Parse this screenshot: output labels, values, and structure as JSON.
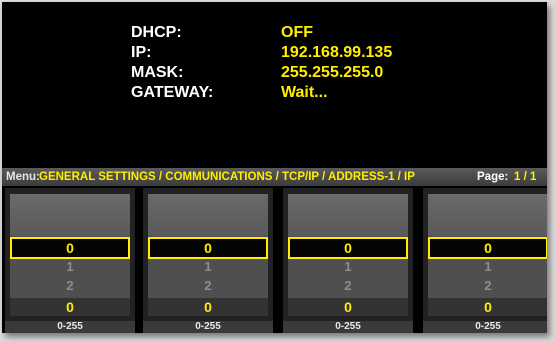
{
  "info": [
    {
      "label": "DHCP:",
      "value": "OFF"
    },
    {
      "label": "IP:",
      "value": "192.168.99.135"
    },
    {
      "label": "MASK:",
      "value": "255.255.255.0"
    },
    {
      "label": "GATEWAY:",
      "value": "Wait..."
    }
  ],
  "menu": {
    "label": "Menu:",
    "path": "GENERAL SETTINGS / COMMUNICATIONS / TCP/IP / ADDRESS-1 / IP",
    "page_label": "Page:",
    "page_value": "1 / 1"
  },
  "columns": [
    {
      "selected": "0",
      "options": [
        "1",
        "2"
      ],
      "current": "0",
      "range": "0-255"
    },
    {
      "selected": "0",
      "options": [
        "1",
        "2"
      ],
      "current": "0",
      "range": "0-255"
    },
    {
      "selected": "0",
      "options": [
        "1",
        "2"
      ],
      "current": "0",
      "range": "0-255"
    },
    {
      "selected": "0",
      "options": [
        "1",
        "2"
      ],
      "current": "0",
      "range": "0-255"
    }
  ],
  "colors": {
    "accent": "#ffee00",
    "background": "#000000",
    "text": "#ffffff"
  }
}
